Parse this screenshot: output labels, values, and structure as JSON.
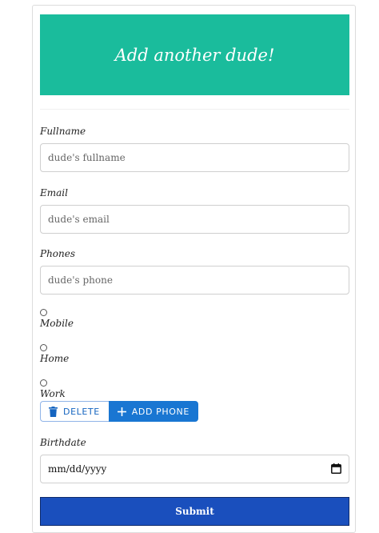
{
  "header": {
    "title": "Add another dude!"
  },
  "form": {
    "fullname": {
      "label": "Fullname",
      "placeholder": "dude's fullname"
    },
    "email": {
      "label": "Email",
      "placeholder": "dude's email"
    },
    "phones": {
      "label": "Phones",
      "placeholder": "dude's phone"
    },
    "phone_types": [
      "Mobile",
      "Home",
      "Work"
    ],
    "buttons": {
      "delete": "DELETE",
      "add_phone": "ADD PHONE"
    },
    "birthdate": {
      "label": "Birthdate",
      "value": "mm/dd/yyyy"
    },
    "submit": "Submit"
  },
  "colors": {
    "header_bg": "#1abc9c",
    "add_button": "#1976d2",
    "submit_bg": "#1a4fbd"
  },
  "icons": {
    "delete": "trash-icon",
    "add": "plus-icon",
    "date": "calendar-icon"
  }
}
